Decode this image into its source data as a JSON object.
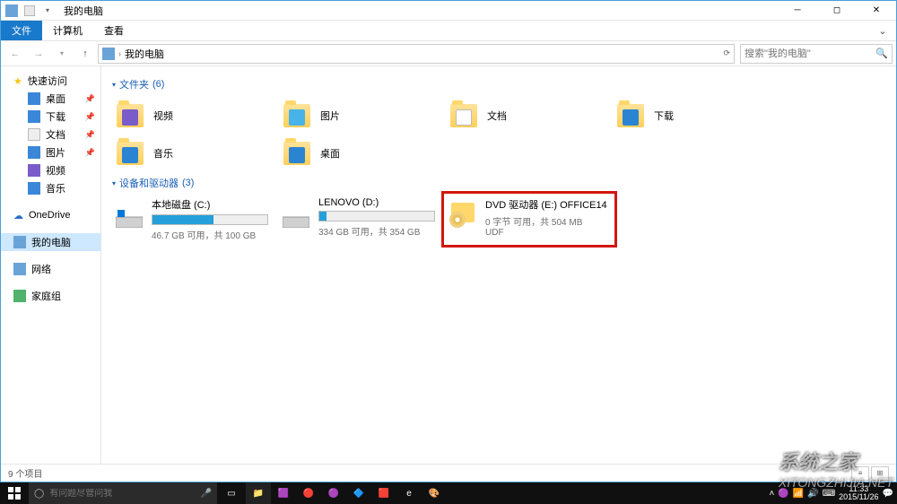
{
  "title": "我的电脑",
  "ribbon": {
    "file": "文件",
    "computer": "计算机",
    "view": "查看"
  },
  "breadcrumb": {
    "item": "我的电脑"
  },
  "search": {
    "placeholder": "搜索\"我的电脑\""
  },
  "sidebar": {
    "quick": "快速访问",
    "items": [
      "桌面",
      "下载",
      "文档",
      "图片",
      "视频",
      "音乐"
    ],
    "onedrive": "OneDrive",
    "thispc": "我的电脑",
    "network": "网络",
    "homegroup": "家庭组"
  },
  "groups": {
    "folders": {
      "label": "文件夹",
      "count": "(6)"
    },
    "devices": {
      "label": "设备和驱动器",
      "count": "(3)"
    }
  },
  "folders": [
    {
      "name": "视频"
    },
    {
      "name": "图片"
    },
    {
      "name": "文档"
    },
    {
      "name": "下载"
    },
    {
      "name": "音乐"
    },
    {
      "name": "桌面"
    }
  ],
  "drives": [
    {
      "name": "本地磁盘 (C:)",
      "subtitle": "46.7 GB 可用，共 100 GB",
      "fill_pct": 53
    },
    {
      "name": "LENOVO (D:)",
      "subtitle": "334 GB 可用，共 354 GB",
      "fill_pct": 6
    },
    {
      "name": "DVD 驱动器 (E:) OFFICE14",
      "line2": "0 字节 可用，共 504 MB",
      "line3": "UDF"
    }
  ],
  "status": {
    "items": "9 个项目"
  },
  "taskbar": {
    "search_placeholder": "有问题尽管问我",
    "time": "11:33",
    "date": "2015/11/26"
  },
  "watermark": {
    "line1": "系统之家",
    "line2": "XITONGZHIJIA.NET"
  }
}
